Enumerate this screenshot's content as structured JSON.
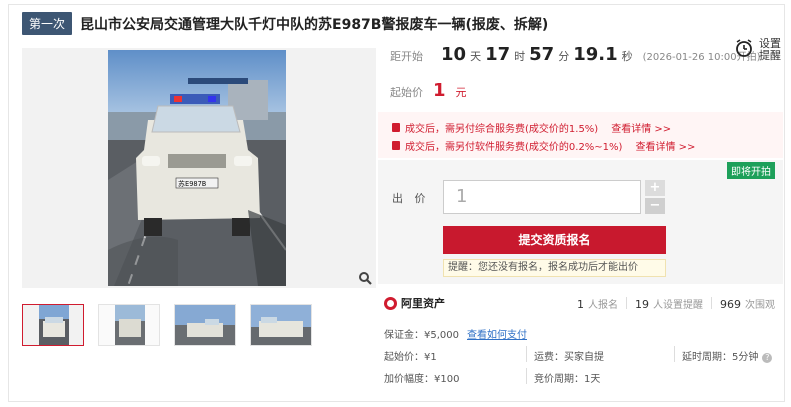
{
  "header": {
    "round_badge": "第一次",
    "title": "昆山市公安局交通管理大队千灯中队的苏E987B警报废车一辆(报废、拆解)"
  },
  "countdown": {
    "label": "距开始",
    "days": "10",
    "days_unit": "天",
    "hours": "17",
    "hours_unit": "时",
    "minutes": "57",
    "minutes_unit": "分",
    "seconds": "19.1",
    "seconds_unit": "秒",
    "start_note": "(2026-01-26 10:00开拍)"
  },
  "reminder": {
    "label": "设置提醒",
    "icon": "alarm-clock-icon"
  },
  "start_price": {
    "label": "起始价",
    "value": "1",
    "unit": "元"
  },
  "fees": [
    {
      "text": "成交后，需另付综合服务费(成交价的1.5%)",
      "link": "查看详情 >>"
    },
    {
      "text": "成交后，需另付软件服务费(成交价的0.2%~1%)",
      "link": "查看详情 >>"
    }
  ],
  "bid": {
    "tag": "即将开拍",
    "label": "出 价",
    "value": "1",
    "plus": "+",
    "minus": "−",
    "submit": "提交资质报名",
    "hint": "提醒：您还没有报名，报名成功后才能出价"
  },
  "stats": {
    "platform": "阿里资产",
    "signups": "1",
    "signups_label": "人报名",
    "reminders": "19",
    "reminders_label": "人设置提醒",
    "views": "969",
    "views_label": "次围观"
  },
  "details": {
    "deposit": "保证金：¥5,000",
    "deposit_link": "查看如何支付",
    "start_price": "起始价：¥1",
    "shipping": "运费：买家自提",
    "delay": "延时周期：5分钟",
    "increment": "加价幅度：¥100",
    "bid_cycle": "竞价周期：1天"
  },
  "colors": {
    "accent": "#c8192e",
    "badge": "#3d5673",
    "upcoming": "#1da05a",
    "link": "#2f70c6"
  }
}
